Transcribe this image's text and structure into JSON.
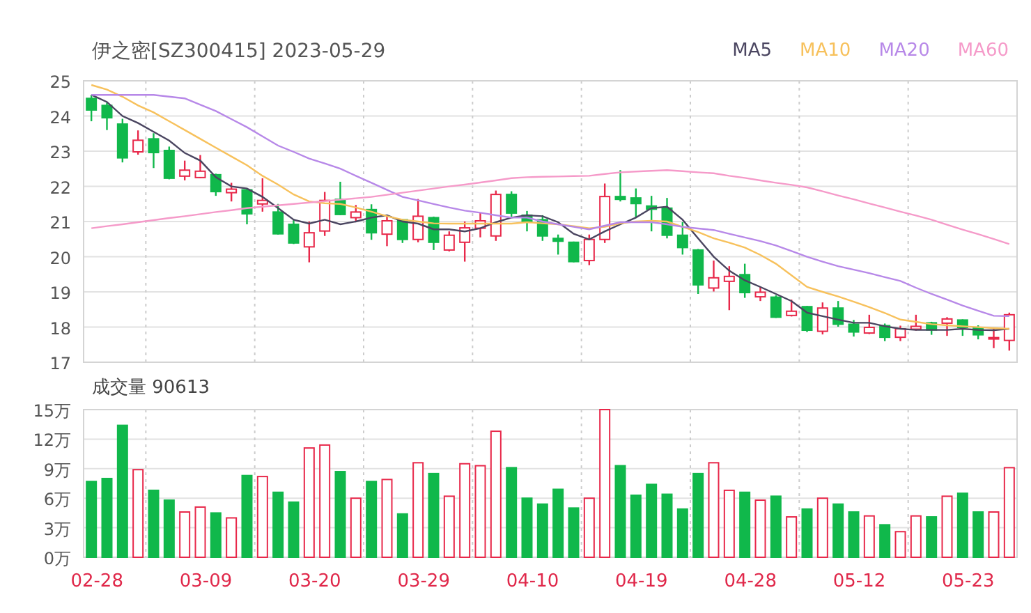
{
  "header": {
    "title": "伊之密[SZ300415] 2023-05-29"
  },
  "price_chart": {
    "chart_data": {
      "type": "candlestick",
      "grid": true,
      "ylim": [
        17,
        25
      ],
      "yticks": [
        17,
        18,
        19,
        20,
        21,
        22,
        23,
        24,
        25
      ],
      "series": [
        {
          "name": "MA5",
          "type": "line",
          "color": "#4a4560",
          "values": [
            24.6,
            24.4,
            24.0,
            23.8,
            23.55,
            23.3,
            22.95,
            22.73,
            22.26,
            22.0,
            21.94,
            21.7,
            21.38,
            21.05,
            20.94,
            21.05,
            20.92,
            21.0,
            21.11,
            21.18,
            21.0,
            20.94,
            20.78,
            20.78,
            20.72,
            20.81,
            20.98,
            21.11,
            21.18,
            21.15,
            20.98,
            20.65,
            20.49,
            20.72,
            20.92,
            21.11,
            21.38,
            21.42,
            21.05,
            20.52,
            20.0,
            19.6,
            19.33,
            19.14,
            18.94,
            18.74,
            18.41,
            18.31,
            18.21,
            18.12,
            18.12,
            18.02,
            17.95,
            17.92,
            17.92,
            17.92,
            17.95,
            17.92,
            17.91,
            17.95
          ]
        },
        {
          "name": "MA10",
          "type": "line",
          "color": "#f7c15c",
          "values": [
            24.88,
            24.75,
            24.55,
            24.3,
            24.1,
            23.85,
            23.6,
            23.35,
            23.1,
            22.85,
            22.6,
            22.3,
            22.05,
            21.77,
            21.57,
            21.52,
            21.5,
            21.4,
            21.28,
            21.15,
            21.05,
            21.0,
            20.95,
            20.94,
            20.94,
            20.94,
            20.94,
            20.94,
            20.98,
            20.95,
            20.92,
            20.87,
            20.81,
            20.85,
            20.95,
            21.0,
            21.02,
            21.0,
            20.85,
            20.7,
            20.52,
            20.4,
            20.26,
            20.05,
            19.8,
            19.47,
            19.14,
            19.0,
            18.87,
            18.72,
            18.57,
            18.4,
            18.21,
            18.15,
            18.08,
            18.05,
            18.02,
            18.0,
            17.97,
            17.95
          ]
        },
        {
          "name": "MA20",
          "type": "line",
          "color": "#b788e8",
          "values": [
            24.6,
            24.6,
            24.6,
            24.6,
            24.6,
            24.55,
            24.5,
            24.32,
            24.14,
            23.91,
            23.68,
            23.42,
            23.16,
            22.98,
            22.79,
            22.65,
            22.5,
            22.3,
            22.1,
            21.9,
            21.7,
            21.6,
            21.5,
            21.4,
            21.31,
            21.25,
            21.18,
            21.11,
            21.11,
            21.0,
            20.92,
            20.85,
            20.78,
            20.88,
            20.98,
            20.98,
            20.98,
            20.92,
            20.85,
            20.8,
            20.76,
            20.65,
            20.55,
            20.44,
            20.32,
            20.16,
            20.0,
            19.86,
            19.73,
            19.63,
            19.53,
            19.42,
            19.31,
            19.12,
            18.94,
            18.78,
            18.61,
            18.46,
            18.32,
            18.31
          ]
        },
        {
          "name": "MA60",
          "type": "line",
          "color": "#f59ac9",
          "values": [
            20.81,
            20.87,
            20.92,
            20.98,
            21.04,
            21.1,
            21.15,
            21.21,
            21.27,
            21.32,
            21.38,
            21.42,
            21.46,
            21.5,
            21.54,
            21.58,
            21.62,
            21.66,
            21.7,
            21.76,
            21.82,
            21.88,
            21.94,
            22.0,
            22.05,
            22.11,
            22.17,
            22.23,
            22.26,
            22.27,
            22.28,
            22.29,
            22.3,
            22.35,
            22.4,
            22.42,
            22.44,
            22.46,
            22.43,
            22.4,
            22.37,
            22.3,
            22.24,
            22.17,
            22.1,
            22.04,
            21.97,
            21.86,
            21.74,
            21.63,
            21.51,
            21.4,
            21.28,
            21.17,
            21.05,
            20.91,
            20.77,
            20.64,
            20.5,
            20.36
          ]
        }
      ],
      "ohlc": [
        [
          24.5,
          24.6,
          23.85,
          24.17
        ],
        [
          24.3,
          24.38,
          23.6,
          23.95
        ],
        [
          23.77,
          23.92,
          22.68,
          22.81
        ],
        [
          22.98,
          23.59,
          22.9,
          23.31
        ],
        [
          23.35,
          23.51,
          22.52,
          22.96
        ],
        [
          23.02,
          23.13,
          22.2,
          22.23
        ],
        [
          22.29,
          22.73,
          22.17,
          22.46
        ],
        [
          22.25,
          22.89,
          22.23,
          22.43
        ],
        [
          22.33,
          22.36,
          21.73,
          21.85
        ],
        [
          21.82,
          22.1,
          21.57,
          21.92
        ],
        [
          21.9,
          21.94,
          20.92,
          21.22
        ],
        [
          21.5,
          22.23,
          21.28,
          21.6
        ],
        [
          21.27,
          21.5,
          20.63,
          20.65
        ],
        [
          20.92,
          21.07,
          20.36,
          20.39
        ],
        [
          20.28,
          21.0,
          19.84,
          20.68
        ],
        [
          20.73,
          21.84,
          20.59,
          21.6
        ],
        [
          21.63,
          22.13,
          21.18,
          21.2
        ],
        [
          21.11,
          21.47,
          20.98,
          21.27
        ],
        [
          21.34,
          21.49,
          20.48,
          20.68
        ],
        [
          20.64,
          21.18,
          20.3,
          21.02
        ],
        [
          21.05,
          21.07,
          20.39,
          20.49
        ],
        [
          20.49,
          21.64,
          20.41,
          21.15
        ],
        [
          21.11,
          21.14,
          20.19,
          20.41
        ],
        [
          20.19,
          20.72,
          20.15,
          20.61
        ],
        [
          20.41,
          21.0,
          19.86,
          20.82
        ],
        [
          20.81,
          21.25,
          20.55,
          21.02
        ],
        [
          20.59,
          21.88,
          20.45,
          21.77
        ],
        [
          21.77,
          21.86,
          21.14,
          21.24
        ],
        [
          21.18,
          21.3,
          20.72,
          20.98
        ],
        [
          21.05,
          21.18,
          20.45,
          20.59
        ],
        [
          20.52,
          20.63,
          20.06,
          20.44
        ],
        [
          20.41,
          20.43,
          19.84,
          19.86
        ],
        [
          19.89,
          20.63,
          19.76,
          20.49
        ],
        [
          20.49,
          22.08,
          20.39,
          21.71
        ],
        [
          21.71,
          22.46,
          21.57,
          21.63
        ],
        [
          21.67,
          21.94,
          21.11,
          21.51
        ],
        [
          21.44,
          21.73,
          20.72,
          21.35
        ],
        [
          21.38,
          21.67,
          20.52,
          20.61
        ],
        [
          20.61,
          20.98,
          20.06,
          20.26
        ],
        [
          20.19,
          20.22,
          18.94,
          19.2
        ],
        [
          19.11,
          19.89,
          19.01,
          19.4
        ],
        [
          19.3,
          19.73,
          18.48,
          19.44
        ],
        [
          19.49,
          19.8,
          18.83,
          18.98
        ],
        [
          18.86,
          19.14,
          18.74,
          18.99
        ],
        [
          18.85,
          18.9,
          18.26,
          18.28
        ],
        [
          18.33,
          18.78,
          18.3,
          18.45
        ],
        [
          18.58,
          18.6,
          17.86,
          17.91
        ],
        [
          17.88,
          18.7,
          17.79,
          18.54
        ],
        [
          18.54,
          18.74,
          18.01,
          18.08
        ],
        [
          18.08,
          18.2,
          17.73,
          17.86
        ],
        [
          17.83,
          18.35,
          17.8,
          17.99
        ],
        [
          18.04,
          18.1,
          17.6,
          17.71
        ],
        [
          17.71,
          18.04,
          17.6,
          17.95
        ],
        [
          17.94,
          18.35,
          17.9,
          18.02
        ],
        [
          18.12,
          18.15,
          17.78,
          17.92
        ],
        [
          18.11,
          18.28,
          17.75,
          18.23
        ],
        [
          18.2,
          18.22,
          17.75,
          17.99
        ],
        [
          17.99,
          18.05,
          17.65,
          17.78
        ],
        [
          17.68,
          17.97,
          17.4,
          17.7
        ],
        [
          17.62,
          18.41,
          17.33,
          18.35
        ]
      ]
    }
  },
  "volume_chart": {
    "label": "成交量 90613",
    "date_labels": [
      "02-28",
      "03-09",
      "03-20",
      "03-29",
      "04-10",
      "04-19",
      "04-28",
      "05-12",
      "05-23"
    ],
    "chart_data": {
      "type": "bar",
      "grid": true,
      "ylim": [
        0,
        15
      ],
      "yticks": [
        {
          "value": 0,
          "label": "0万"
        },
        {
          "value": 3,
          "label": "3万"
        },
        {
          "value": 6,
          "label": "6万"
        },
        {
          "value": 9,
          "label": "9万"
        },
        {
          "value": 12,
          "label": "12万"
        },
        {
          "value": 15,
          "label": "15万"
        }
      ],
      "values": [
        7.7,
        8.0,
        13.4,
        8.9,
        6.8,
        5.8,
        4.6,
        5.1,
        4.5,
        4.0,
        8.3,
        8.2,
        6.6,
        5.6,
        11.1,
        11.4,
        8.7,
        6.0,
        7.7,
        7.9,
        4.4,
        9.6,
        8.5,
        6.2,
        9.5,
        9.3,
        12.8,
        9.1,
        6.0,
        5.4,
        6.9,
        5.0,
        6.0,
        15.0,
        9.3,
        6.3,
        7.4,
        6.4,
        4.9,
        8.5,
        9.6,
        6.8,
        6.6,
        5.8,
        6.2,
        4.1,
        4.9,
        6.0,
        5.4,
        4.6,
        4.2,
        3.3,
        2.6,
        4.2,
        4.1,
        6.2,
        6.5,
        4.6,
        4.6,
        9.1
      ]
    }
  }
}
